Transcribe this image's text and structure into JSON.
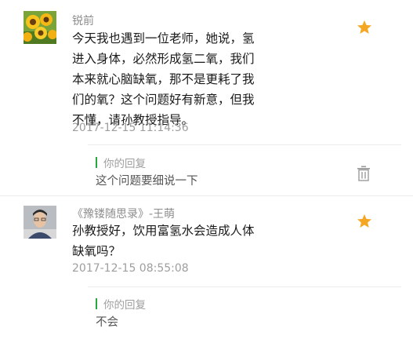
{
  "comments": [
    {
      "author": "锐前",
      "avatar_icon": "sunflower-avatar",
      "lines": [
        "今天我也遇到一位老师，她说，氢",
        "进入身体，必然形成氢二氧，我们",
        "本来就心脑缺氧，那不是更耗了我",
        "们的氧？这个问题好有新意，但我",
        "不懂，请孙教授指导。"
      ],
      "timestamp": "2017-12-15 11:14:36",
      "reply_label": "你的回复",
      "reply_text": "这个问题要细说一下",
      "star_icon": "star-icon",
      "delete_icon": "trash-icon"
    },
    {
      "author": "《豫镂随思录》-王萌",
      "avatar_icon": "person-avatar",
      "lines": [
        "孙教授好，饮用富氢水会造成人体",
        "缺氧吗？"
      ],
      "timestamp": "2017-12-15 08:55:08",
      "reply_label": "你的回复",
      "reply_text": "不会",
      "star_icon": "star-icon"
    }
  ],
  "colors": {
    "star": "#f5a623",
    "reply_bar": "#25a83c",
    "timestamp": "#9e9e9e",
    "author": "#8c8c8c"
  }
}
